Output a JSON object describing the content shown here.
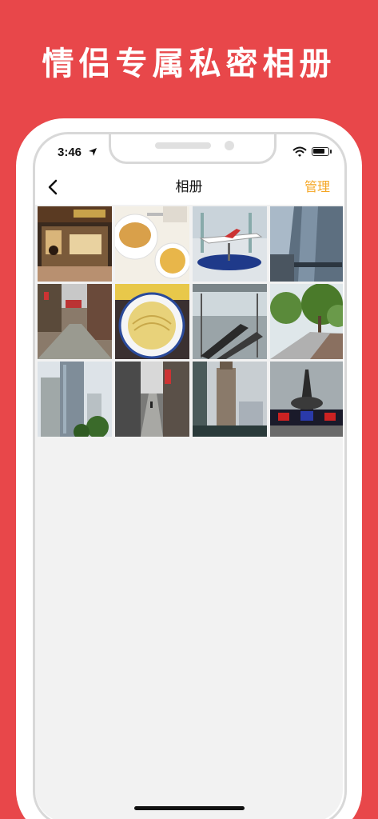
{
  "promo": {
    "title": "情侣专属私密相册"
  },
  "status_bar": {
    "time": "3:46",
    "battery_level": 0.85
  },
  "nav": {
    "title": "相册",
    "right_action": "管理",
    "back_icon": "chevron-left-icon"
  },
  "colors": {
    "background": "#e8474a",
    "accent": "#f5a623",
    "screen_bg": "#f2f2f2"
  },
  "photos": [
    {
      "subject": "restaurant-storefront"
    },
    {
      "subject": "bread-and-soup"
    },
    {
      "subject": "airplane-exhibit"
    },
    {
      "subject": "glass-tower"
    },
    {
      "subject": "old-street"
    },
    {
      "subject": "noodle-bowl"
    },
    {
      "subject": "mall-escalators"
    },
    {
      "subject": "tree-lined-road"
    },
    {
      "subject": "skyscrapers"
    },
    {
      "subject": "narrow-alley"
    },
    {
      "subject": "tall-tower"
    },
    {
      "subject": "tower-at-dusk"
    }
  ]
}
